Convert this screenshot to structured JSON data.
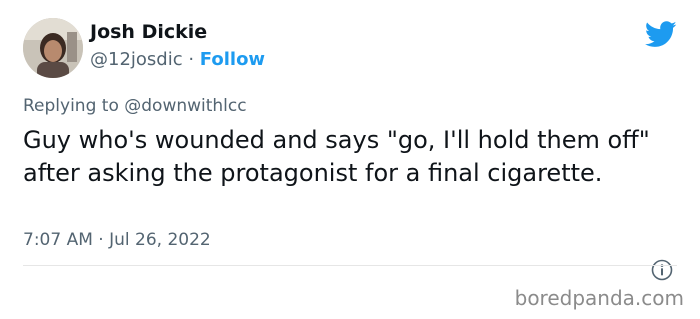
{
  "tweet": {
    "author": {
      "name": "Josh Dickie",
      "handle": "@12josdic",
      "separator": " · ",
      "follow_label": "Follow"
    },
    "replying_prefix": "Replying to ",
    "replying_to": "@downwithlcc",
    "text": "Guy who's wounded and says \"go, I'll hold them off\" after asking the protagonist for a final cigarette.",
    "timestamp": "7:07 AM · Jul 26, 2022"
  },
  "icons": {
    "brand": "twitter-bird-icon",
    "info": "info-icon"
  },
  "colors": {
    "accent": "#1d9bf0",
    "muted_text": "#536471",
    "primary_text": "#0f1419"
  },
  "watermark": "boredpanda.com"
}
